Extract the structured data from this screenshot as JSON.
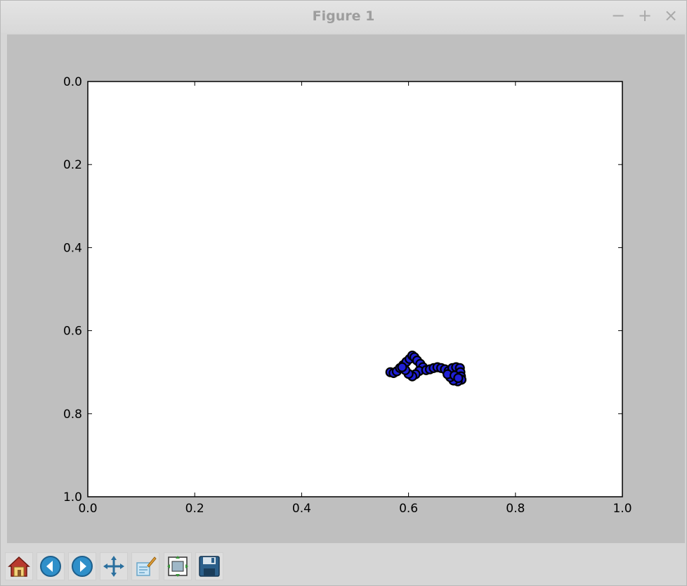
{
  "window": {
    "title": "Figure 1",
    "buttons": [
      {
        "name": "minimize",
        "glyph": "−"
      },
      {
        "name": "maximize",
        "glyph": "+"
      },
      {
        "name": "close",
        "glyph": "×"
      }
    ]
  },
  "toolbar": {
    "buttons": [
      {
        "name": "home",
        "icon": "home-icon"
      },
      {
        "name": "back",
        "icon": "arrow-left-icon"
      },
      {
        "name": "forward",
        "icon": "arrow-right-icon"
      },
      {
        "name": "pan",
        "icon": "move-arrows-icon"
      },
      {
        "name": "zoom",
        "icon": "zoom-rect-icon"
      },
      {
        "name": "configure-subplots",
        "icon": "subplots-icon"
      },
      {
        "name": "save",
        "icon": "floppy-disk-icon"
      }
    ]
  },
  "colors": {
    "marker_fill": "#1f1fd6",
    "marker_edge": "#000000",
    "canvas_bg": "#bfbfbf",
    "axes_bg": "#ffffff"
  },
  "chart_data": {
    "type": "scatter",
    "title": "",
    "xlabel": "",
    "ylabel": "",
    "xlim": [
      0.0,
      1.0
    ],
    "ylim": [
      1.0,
      0.0
    ],
    "y_inverted": true,
    "grid": false,
    "xticks": [
      "0.0",
      "0.2",
      "0.4",
      "0.6",
      "0.8",
      "1.0"
    ],
    "yticks": [
      "0.0",
      "0.2",
      "0.4",
      "0.6",
      "0.8",
      "1.0"
    ],
    "series": [
      {
        "marker": "circle",
        "points": [
          [
            0.566,
            0.7
          ],
          [
            0.572,
            0.702
          ],
          [
            0.578,
            0.698
          ],
          [
            0.584,
            0.69
          ],
          [
            0.59,
            0.683
          ],
          [
            0.596,
            0.675
          ],
          [
            0.602,
            0.668
          ],
          [
            0.607,
            0.66
          ],
          [
            0.611,
            0.664
          ],
          [
            0.616,
            0.672
          ],
          [
            0.622,
            0.68
          ],
          [
            0.627,
            0.688
          ],
          [
            0.62,
            0.697
          ],
          [
            0.613,
            0.705
          ],
          [
            0.607,
            0.71
          ],
          [
            0.6,
            0.704
          ],
          [
            0.594,
            0.695
          ],
          [
            0.588,
            0.688
          ],
          [
            0.633,
            0.695
          ],
          [
            0.64,
            0.693
          ],
          [
            0.647,
            0.69
          ],
          [
            0.654,
            0.688
          ],
          [
            0.661,
            0.69
          ],
          [
            0.668,
            0.693
          ],
          [
            0.675,
            0.697
          ],
          [
            0.682,
            0.69
          ],
          [
            0.689,
            0.688
          ],
          [
            0.696,
            0.69
          ],
          [
            0.697,
            0.7
          ],
          [
            0.698,
            0.71
          ],
          [
            0.699,
            0.718
          ],
          [
            0.692,
            0.722
          ],
          [
            0.684,
            0.72
          ],
          [
            0.678,
            0.712
          ],
          [
            0.673,
            0.705
          ],
          [
            0.686,
            0.708
          ],
          [
            0.693,
            0.714
          ]
        ]
      }
    ]
  }
}
